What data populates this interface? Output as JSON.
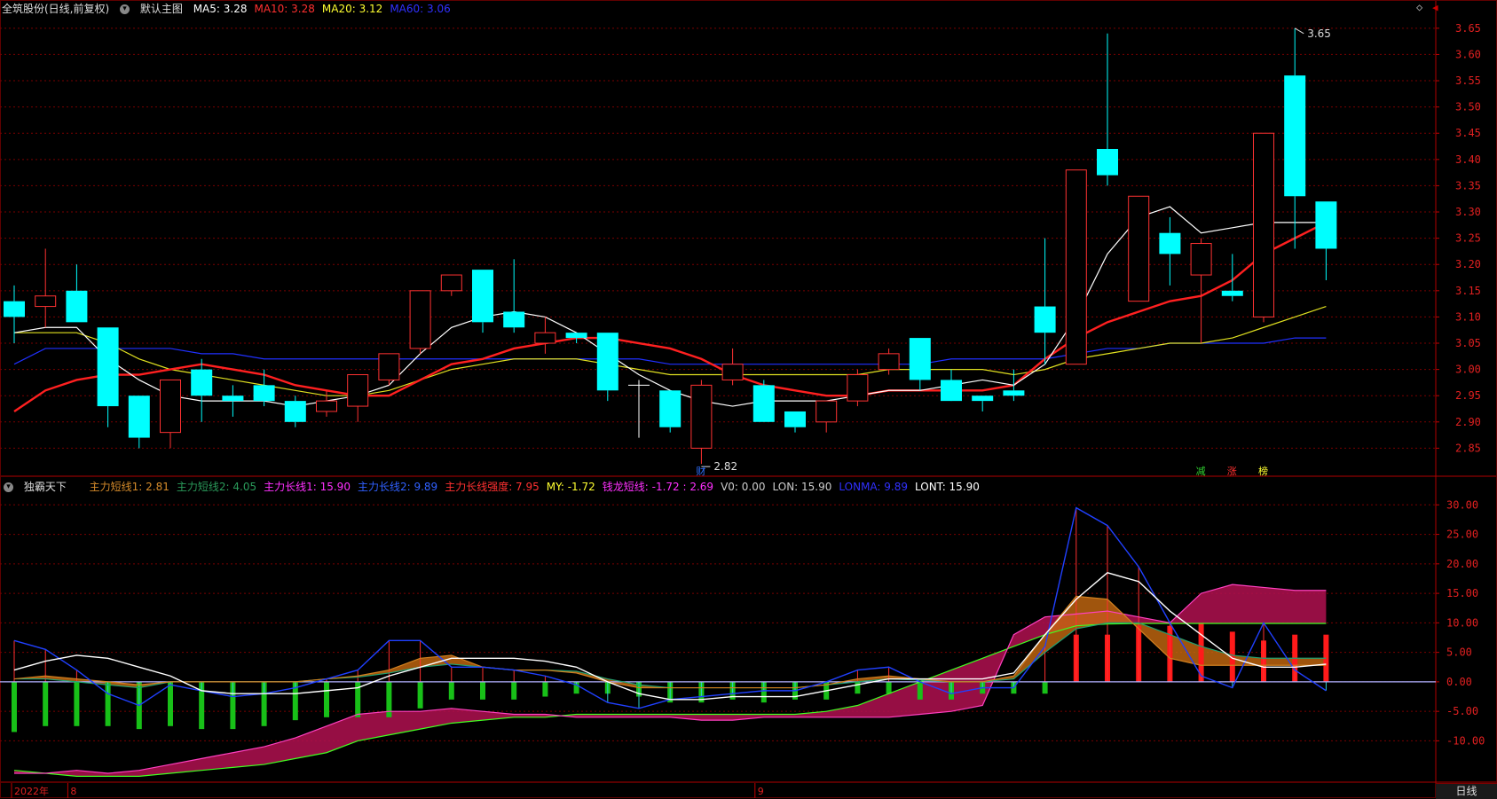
{
  "main_header": {
    "stock_title": "全筑股份(日线,前复权)",
    "indicator_name": "默认主图",
    "ma": [
      {
        "label": "MA5: 3.28",
        "color": "#ffffff"
      },
      {
        "label": "MA10: 3.28",
        "color": "#ff3030"
      },
      {
        "label": "MA20: 3.12",
        "color": "#ffff30"
      },
      {
        "label": "MA60: 3.06",
        "color": "#3030ff"
      }
    ]
  },
  "sub_header": {
    "indicator_name": "独霸天下",
    "items": [
      {
        "label": "主力短线1: 2.81",
        "color": "#d48a2a"
      },
      {
        "label": "主力短线2: 4.05",
        "color": "#2a9a5a"
      },
      {
        "label": "主力长线1: 15.90",
        "color": "#ff30ff"
      },
      {
        "label": "主力长线2: 9.89",
        "color": "#3060ff"
      },
      {
        "label": "主力长线强度: 7.95",
        "color": "#ff3030"
      },
      {
        "label": "MY: -1.72",
        "color": "#ffff30"
      },
      {
        "label": "钱龙短线: -1.72 : 2.69",
        "color": "#ff30ff"
      },
      {
        "label": "V0: 0.00",
        "color": "#cccccc"
      },
      {
        "label": "LON: 15.90",
        "color": "#cccccc"
      },
      {
        "label": "LONMA: 9.89",
        "color": "#3030ff"
      },
      {
        "label": "LONT: 15.90",
        "color": "#ffffff"
      }
    ]
  },
  "price_axis": [
    "3.65",
    "3.60",
    "3.55",
    "3.50",
    "3.45",
    "3.40",
    "3.35",
    "3.30",
    "3.25",
    "3.20",
    "3.15",
    "3.10",
    "3.05",
    "3.00",
    "2.95",
    "2.90",
    "2.85"
  ],
  "sub_axis": [
    "30.00",
    "25.00",
    "20.00",
    "15.00",
    "10.00",
    "5.00",
    "0.00",
    "-5.00",
    "-10.00"
  ],
  "annotations": {
    "high": "3.65",
    "low": "2.82"
  },
  "event_markers": [
    {
      "label": "财",
      "color": "#3070ff"
    },
    {
      "label": "减",
      "color": "#30d030"
    },
    {
      "label": "涨",
      "color": "#ff3030"
    },
    {
      "label": "榜",
      "color": "#ffff30"
    }
  ],
  "time_axis": [
    "2022年",
    "8",
    "9"
  ],
  "period_label": "日线",
  "colors": {
    "up": "#ff3232",
    "down": "#00ffff",
    "grid": "#7a0000"
  },
  "chart_data": {
    "type": "candlestick",
    "ylim": [
      2.8,
      3.67
    ],
    "candles": [
      {
        "o": 3.13,
        "h": 3.16,
        "l": 3.05,
        "c": 3.1
      },
      {
        "o": 3.12,
        "h": 3.23,
        "l": 3.08,
        "c": 3.14
      },
      {
        "o": 3.15,
        "h": 3.2,
        "l": 3.09,
        "c": 3.09
      },
      {
        "o": 3.08,
        "h": 3.08,
        "l": 2.89,
        "c": 2.93
      },
      {
        "o": 2.95,
        "h": 2.95,
        "l": 2.85,
        "c": 2.87
      },
      {
        "o": 2.88,
        "h": 2.98,
        "l": 2.85,
        "c": 2.98
      },
      {
        "o": 3.0,
        "h": 3.02,
        "l": 2.9,
        "c": 2.95
      },
      {
        "o": 2.95,
        "h": 2.97,
        "l": 2.91,
        "c": 2.94
      },
      {
        "o": 2.97,
        "h": 3.0,
        "l": 2.93,
        "c": 2.94
      },
      {
        "o": 2.94,
        "h": 2.95,
        "l": 2.89,
        "c": 2.9
      },
      {
        "o": 2.92,
        "h": 2.96,
        "l": 2.91,
        "c": 2.94
      },
      {
        "o": 2.93,
        "h": 2.99,
        "l": 2.9,
        "c": 2.99
      },
      {
        "o": 2.98,
        "h": 3.03,
        "l": 2.97,
        "c": 3.03
      },
      {
        "o": 3.04,
        "h": 3.15,
        "l": 3.03,
        "c": 3.15
      },
      {
        "o": 3.15,
        "h": 3.18,
        "l": 3.14,
        "c": 3.18
      },
      {
        "o": 3.19,
        "h": 3.19,
        "l": 3.07,
        "c": 3.09
      },
      {
        "o": 3.11,
        "h": 3.21,
        "l": 3.07,
        "c": 3.08
      },
      {
        "o": 3.05,
        "h": 3.1,
        "l": 3.03,
        "c": 3.07
      },
      {
        "o": 3.07,
        "h": 3.07,
        "l": 3.05,
        "c": 3.06
      },
      {
        "o": 3.07,
        "h": 3.07,
        "l": 2.94,
        "c": 2.96
      },
      {
        "o": 2.97,
        "h": 2.98,
        "l": 2.87,
        "c": 2.97
      },
      {
        "o": 2.96,
        "h": 2.96,
        "l": 2.88,
        "c": 2.89
      },
      {
        "o": 2.85,
        "h": 2.98,
        "l": 2.82,
        "c": 2.97
      },
      {
        "o": 2.98,
        "h": 3.04,
        "l": 2.97,
        "c": 3.01
      },
      {
        "o": 2.97,
        "h": 2.98,
        "l": 2.9,
        "c": 2.9
      },
      {
        "o": 2.92,
        "h": 2.92,
        "l": 2.88,
        "c": 2.89
      },
      {
        "o": 2.9,
        "h": 2.94,
        "l": 2.88,
        "c": 2.94
      },
      {
        "o": 2.94,
        "h": 3.0,
        "l": 2.93,
        "c": 2.99
      },
      {
        "o": 3.0,
        "h": 3.04,
        "l": 2.99,
        "c": 3.03
      },
      {
        "o": 3.06,
        "h": 3.06,
        "l": 2.96,
        "c": 2.98
      },
      {
        "o": 2.98,
        "h": 3.0,
        "l": 2.95,
        "c": 2.94
      },
      {
        "o": 2.95,
        "h": 2.95,
        "l": 2.92,
        "c": 2.94
      },
      {
        "o": 2.96,
        "h": 3.0,
        "l": 2.94,
        "c": 2.95
      },
      {
        "o": 3.12,
        "h": 3.25,
        "l": 3.01,
        "c": 3.07
      },
      {
        "o": 3.01,
        "h": 3.38,
        "l": 3.01,
        "c": 3.38
      },
      {
        "o": 3.42,
        "h": 3.64,
        "l": 3.35,
        "c": 3.37
      },
      {
        "o": 3.13,
        "h": 3.33,
        "l": 3.13,
        "c": 3.33
      },
      {
        "o": 3.26,
        "h": 3.29,
        "l": 3.16,
        "c": 3.22
      },
      {
        "o": 3.18,
        "h": 3.25,
        "l": 3.05,
        "c": 3.24
      },
      {
        "o": 3.15,
        "h": 3.22,
        "l": 3.13,
        "c": 3.14
      },
      {
        "o": 3.1,
        "h": 3.45,
        "l": 3.09,
        "c": 3.45
      },
      {
        "o": 3.56,
        "h": 3.65,
        "l": 3.23,
        "c": 3.33
      },
      {
        "o": 3.32,
        "h": 3.32,
        "l": 3.17,
        "c": 3.23
      }
    ],
    "ma5": [
      3.07,
      3.08,
      3.08,
      3.02,
      2.98,
      2.95,
      2.94,
      2.94,
      2.94,
      2.93,
      2.94,
      2.95,
      2.97,
      3.03,
      3.08,
      3.1,
      3.11,
      3.1,
      3.07,
      3.03,
      2.99,
      2.96,
      2.94,
      2.93,
      2.94,
      2.94,
      2.94,
      2.95,
      2.96,
      2.96,
      2.97,
      2.98,
      2.97,
      3.01,
      3.1,
      3.22,
      3.29,
      3.31,
      3.26,
      3.27,
      3.28,
      3.28,
      3.28
    ],
    "ma10": [
      2.92,
      2.96,
      2.98,
      2.99,
      2.99,
      3.0,
      3.01,
      3.0,
      2.99,
      2.97,
      2.96,
      2.95,
      2.95,
      2.98,
      3.01,
      3.02,
      3.04,
      3.05,
      3.06,
      3.06,
      3.05,
      3.04,
      3.02,
      2.99,
      2.97,
      2.96,
      2.95,
      2.95,
      2.96,
      2.96,
      2.96,
      2.96,
      2.97,
      3.02,
      3.06,
      3.09,
      3.11,
      3.13,
      3.14,
      3.17,
      3.22,
      3.25,
      3.28
    ],
    "ma20": [
      3.07,
      3.07,
      3.07,
      3.05,
      3.02,
      3.0,
      2.99,
      2.98,
      2.97,
      2.96,
      2.95,
      2.95,
      2.96,
      2.98,
      3.0,
      3.01,
      3.02,
      3.02,
      3.02,
      3.01,
      3.0,
      2.99,
      2.99,
      2.99,
      2.99,
      2.99,
      2.99,
      2.99,
      3.0,
      3.0,
      3.0,
      3.0,
      2.99,
      3.0,
      3.02,
      3.03,
      3.04,
      3.05,
      3.05,
      3.06,
      3.08,
      3.1,
      3.12
    ],
    "ma60": [
      3.01,
      3.04,
      3.04,
      3.04,
      3.04,
      3.04,
      3.03,
      3.03,
      3.02,
      3.02,
      3.02,
      3.02,
      3.02,
      3.02,
      3.02,
      3.02,
      3.02,
      3.02,
      3.02,
      3.02,
      3.02,
      3.01,
      3.01,
      3.01,
      3.01,
      3.01,
      3.01,
      3.01,
      3.01,
      3.01,
      3.02,
      3.02,
      3.02,
      3.02,
      3.03,
      3.04,
      3.04,
      3.05,
      3.05,
      3.05,
      3.05,
      3.06,
      3.06
    ],
    "sub": {
      "ylim": [
        -17,
        32
      ],
      "bars": [
        -8.5,
        -7.5,
        -7.5,
        -7.5,
        -8,
        -7.5,
        -8,
        -8,
        -7.5,
        -6.5,
        -6,
        -6,
        -6,
        -4.5,
        -3,
        -3,
        -3,
        -2.5,
        -2,
        -2,
        -2.5,
        -3.5,
        -3.5,
        -3,
        -3.5,
        -3,
        -3,
        -2,
        -2,
        -3,
        -3,
        -2,
        -2,
        -2,
        8,
        8,
        9.5,
        9.5,
        10,
        8.5,
        7,
        8,
        8
      ],
      "white": [
        2,
        3.5,
        4.5,
        4,
        2.5,
        1,
        -1.5,
        -2,
        -2,
        -2,
        -1.5,
        -1,
        1,
        2.5,
        4,
        4,
        4,
        3.5,
        2.5,
        0,
        -2,
        -3,
        -3,
        -2.5,
        -2.5,
        -2.5,
        -1.5,
        -0.5,
        0.5,
        0.5,
        0.5,
        0.5,
        1.5,
        8,
        14,
        18.5,
        17,
        12,
        8,
        4,
        2.5,
        2.5,
        3
      ],
      "blue": [
        7,
        5.5,
        2,
        -2,
        -4,
        -0.5,
        -1.5,
        -2.5,
        -2,
        -1,
        0.5,
        2,
        7,
        7,
        2.5,
        2.5,
        2,
        1,
        -0.5,
        -3.5,
        -4.5,
        -3,
        -2.5,
        -2,
        -1.5,
        -1.5,
        0,
        2,
        2.5,
        0,
        -2,
        -1,
        -1,
        6,
        29.5,
        26.5,
        19.5,
        10,
        1,
        -1,
        10,
        2,
        -1.5
      ],
      "magenta": [
        -15.5,
        -15.5,
        -15,
        -15.5,
        -15,
        -14,
        -13,
        -12,
        -11,
        -9.5,
        -7.5,
        -5.5,
        -5,
        -5,
        -4.5,
        -5,
        -5.5,
        -5.5,
        -6,
        -6,
        -6,
        -6,
        -6.5,
        -6.5,
        -6,
        -6,
        -6,
        -6,
        -6,
        -5.5,
        -5,
        -4,
        8,
        11,
        11.5,
        12,
        11,
        10,
        15,
        16.5,
        16,
        15.5,
        15.5
      ],
      "green": [
        -15,
        -15.5,
        -16,
        -16,
        -16,
        -15.5,
        -15,
        -14.5,
        -14,
        -13,
        -12,
        -10,
        -9,
        -8,
        -7,
        -6.5,
        -6,
        -6,
        -5.5,
        -5.5,
        -5.5,
        -5.5,
        -5.5,
        -5.5,
        -5.5,
        -5.5,
        -5,
        -4,
        -2,
        0,
        2,
        4,
        6,
        8,
        9.5,
        9.8,
        9.9,
        9.9,
        9.9,
        9.9,
        9.9,
        9.9,
        9.9
      ],
      "orange": [
        0.5,
        1,
        0.5,
        0,
        -0.5,
        0,
        0,
        0,
        0,
        0,
        0.5,
        1,
        2,
        4,
        4.5,
        2.5,
        2,
        2,
        1.5,
        0,
        -1,
        -1,
        -1,
        -1,
        -1,
        -1,
        -0.5,
        0.5,
        1,
        0.5,
        0,
        0,
        1,
        8,
        14.5,
        14,
        9,
        4,
        2.8,
        2.8,
        2.8,
        2.8,
        2.8
      ],
      "teal": [
        0.5,
        0.5,
        0,
        -0.5,
        -1,
        0,
        0,
        0,
        0,
        0,
        0.5,
        0.8,
        1.5,
        2.5,
        3,
        2.5,
        2,
        2,
        1.8,
        0.5,
        -0.5,
        -1,
        -1,
        -1,
        -1,
        -1,
        -0.5,
        0,
        0.5,
        0.3,
        0,
        0,
        0.5,
        5,
        9,
        10,
        10,
        8,
        6,
        4.5,
        4,
        4,
        4
      ]
    }
  }
}
